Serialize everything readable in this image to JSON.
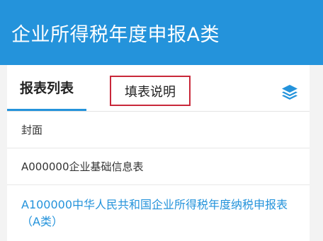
{
  "header": {
    "title": "企业所得税年度申报A类"
  },
  "tabs": {
    "active_label": "报表列表",
    "second_label": "填表说明",
    "layers_icon": "layers-icon"
  },
  "list": {
    "items": [
      {
        "label": "封面"
      },
      {
        "label": "A000000企业基础信息表"
      },
      {
        "label": "A100000中华人民共和国企业所得税年度纳税申报表（A类）"
      }
    ]
  },
  "colors": {
    "header_bg": "#2493db",
    "accent": "#2493db",
    "highlight_border": "#c9283a",
    "panel_bg": "#f3f3f3"
  }
}
